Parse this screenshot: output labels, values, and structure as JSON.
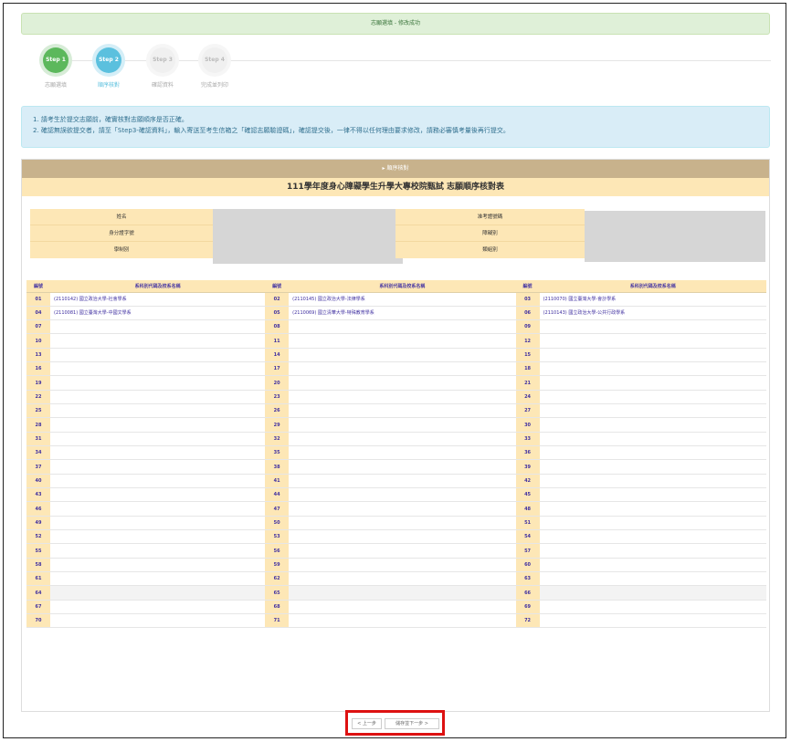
{
  "alert_success": "志願選填 - 修改成功",
  "steps": [
    {
      "badge": "Step 1",
      "label": "志願選填",
      "state": "done"
    },
    {
      "badge": "Step 2",
      "label": "順序核對",
      "state": "active"
    },
    {
      "badge": "Step 3",
      "label": "確認資料",
      "state": "pending"
    },
    {
      "badge": "Step 4",
      "label": "完成並列印",
      "state": "pending"
    }
  ],
  "notice": [
    "1. 請考生於提交志願前，確實核對志願順序是否正確。",
    "2. 確認無誤欲提交者，請至「Step3-確認資料」，輸入寄送至考生信箱之「確認志願驗證碼」，確認提交後，一律不得以任何理由要求修改，請務必審慎考量後再行提交。"
  ],
  "panel": {
    "heading": "▸ 順序核對",
    "title": "111學年度身心障礙學生升學大專校院甄試 志願順序核對表"
  },
  "info_labels": {
    "name": "姓名",
    "id_no": "身分證字號",
    "school_system": "學制別",
    "ticket_no": "准考證號碼",
    "disability": "障礙別",
    "group": "類組別"
  },
  "table": {
    "headers": [
      "編號",
      "系科別代碼及校系名稱",
      "編號",
      "系科別代碼及校系名稱",
      "編號",
      "系科別代碼及校系名稱"
    ],
    "rows": [
      [
        {
          "no": "01",
          "name": "(2110142) 國立政治大學-社會學系"
        },
        {
          "no": "02",
          "name": "(2110145) 國立政治大學-法律學系"
        },
        {
          "no": "03",
          "name": "(2110070) 國立臺灣大學-會計學系"
        }
      ],
      [
        {
          "no": "04",
          "name": "(2110081) 國立臺灣大學-中國文學系"
        },
        {
          "no": "05",
          "name": "(2110069) 國立清華大學-特殊教育學系"
        },
        {
          "no": "06",
          "name": "(2110143) 國立政治大學-公共行政學系"
        }
      ],
      [
        {
          "no": "07",
          "name": ""
        },
        {
          "no": "08",
          "name": ""
        },
        {
          "no": "09",
          "name": ""
        }
      ],
      [
        {
          "no": "10",
          "name": ""
        },
        {
          "no": "11",
          "name": ""
        },
        {
          "no": "12",
          "name": ""
        }
      ],
      [
        {
          "no": "13",
          "name": ""
        },
        {
          "no": "14",
          "name": ""
        },
        {
          "no": "15",
          "name": ""
        }
      ],
      [
        {
          "no": "16",
          "name": ""
        },
        {
          "no": "17",
          "name": ""
        },
        {
          "no": "18",
          "name": ""
        }
      ],
      [
        {
          "no": "19",
          "name": ""
        },
        {
          "no": "20",
          "name": ""
        },
        {
          "no": "21",
          "name": ""
        }
      ],
      [
        {
          "no": "22",
          "name": ""
        },
        {
          "no": "23",
          "name": ""
        },
        {
          "no": "24",
          "name": ""
        }
      ],
      [
        {
          "no": "25",
          "name": ""
        },
        {
          "no": "26",
          "name": ""
        },
        {
          "no": "27",
          "name": ""
        }
      ],
      [
        {
          "no": "28",
          "name": ""
        },
        {
          "no": "29",
          "name": ""
        },
        {
          "no": "30",
          "name": ""
        }
      ],
      [
        {
          "no": "31",
          "name": ""
        },
        {
          "no": "32",
          "name": ""
        },
        {
          "no": "33",
          "name": ""
        }
      ],
      [
        {
          "no": "34",
          "name": ""
        },
        {
          "no": "35",
          "name": ""
        },
        {
          "no": "36",
          "name": ""
        }
      ],
      [
        {
          "no": "37",
          "name": ""
        },
        {
          "no": "38",
          "name": ""
        },
        {
          "no": "39",
          "name": ""
        }
      ],
      [
        {
          "no": "40",
          "name": ""
        },
        {
          "no": "41",
          "name": ""
        },
        {
          "no": "42",
          "name": ""
        }
      ],
      [
        {
          "no": "43",
          "name": ""
        },
        {
          "no": "44",
          "name": ""
        },
        {
          "no": "45",
          "name": ""
        }
      ],
      [
        {
          "no": "46",
          "name": ""
        },
        {
          "no": "47",
          "name": ""
        },
        {
          "no": "48",
          "name": ""
        }
      ],
      [
        {
          "no": "49",
          "name": ""
        },
        {
          "no": "50",
          "name": ""
        },
        {
          "no": "51",
          "name": ""
        }
      ],
      [
        {
          "no": "52",
          "name": ""
        },
        {
          "no": "53",
          "name": ""
        },
        {
          "no": "54",
          "name": ""
        }
      ],
      [
        {
          "no": "55",
          "name": ""
        },
        {
          "no": "56",
          "name": ""
        },
        {
          "no": "57",
          "name": ""
        }
      ],
      [
        {
          "no": "58",
          "name": ""
        },
        {
          "no": "59",
          "name": ""
        },
        {
          "no": "60",
          "name": ""
        }
      ],
      [
        {
          "no": "61",
          "name": ""
        },
        {
          "no": "62",
          "name": ""
        },
        {
          "no": "63",
          "name": ""
        }
      ],
      [
        {
          "no": "64",
          "name": ""
        },
        {
          "no": "65",
          "name": ""
        },
        {
          "no": "66",
          "name": ""
        }
      ],
      [
        {
          "no": "67",
          "name": ""
        },
        {
          "no": "68",
          "name": ""
        },
        {
          "no": "69",
          "name": ""
        }
      ],
      [
        {
          "no": "70",
          "name": ""
        },
        {
          "no": "71",
          "name": ""
        },
        {
          "no": "72",
          "name": ""
        }
      ]
    ]
  },
  "buttons": {
    "prev": "< 上一步",
    "next": "儲存並下一步 >"
  }
}
